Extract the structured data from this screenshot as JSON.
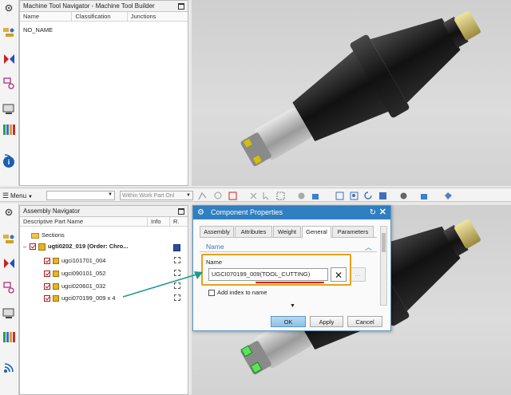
{
  "top": {
    "navigator_title": "Machine Tool Navigator - Machine Tool Builder",
    "columns": [
      "Name",
      "Classification",
      "Junctions"
    ],
    "rows": [
      "NO_NAME"
    ]
  },
  "toolbar": {
    "menu_label": "Menu",
    "filter_value": "",
    "scope_value": "Within Work Part Onl"
  },
  "assembly": {
    "title": "Assembly Navigator",
    "columns": [
      "Descriptive Part Name",
      "Info",
      "R."
    ],
    "items": [
      {
        "label": "Sections",
        "bold": false
      },
      {
        "label": "ugti0202_019 (Order: Chro...",
        "bold": true
      },
      {
        "label": "ugci101701_004",
        "bold": false
      },
      {
        "label": "ugci090101_052",
        "bold": false
      },
      {
        "label": "ugci020601_032",
        "bold": false
      },
      {
        "label": "ugci070199_009 x 4",
        "bold": false
      }
    ]
  },
  "dialog": {
    "title": "Component Properties",
    "tabs": [
      "Assembly",
      "Attributes",
      "Weight",
      "General",
      "Parameters"
    ],
    "active_tab": "General",
    "section_label": "Name",
    "field_label": "Name",
    "name_value": "UGCI070199_009(TOOL_CUTTING)",
    "checkbox_label": "Add index to name",
    "ok_label": "OK",
    "apply_label": "Apply",
    "cancel_label": "Cancel"
  },
  "colors": {
    "dialog_title": "#2f7fc1",
    "highlight_box": "#e3a21a",
    "arrow": "#1e9a8a",
    "underline": "#d81e1e",
    "active_tab": "#ffffff"
  }
}
